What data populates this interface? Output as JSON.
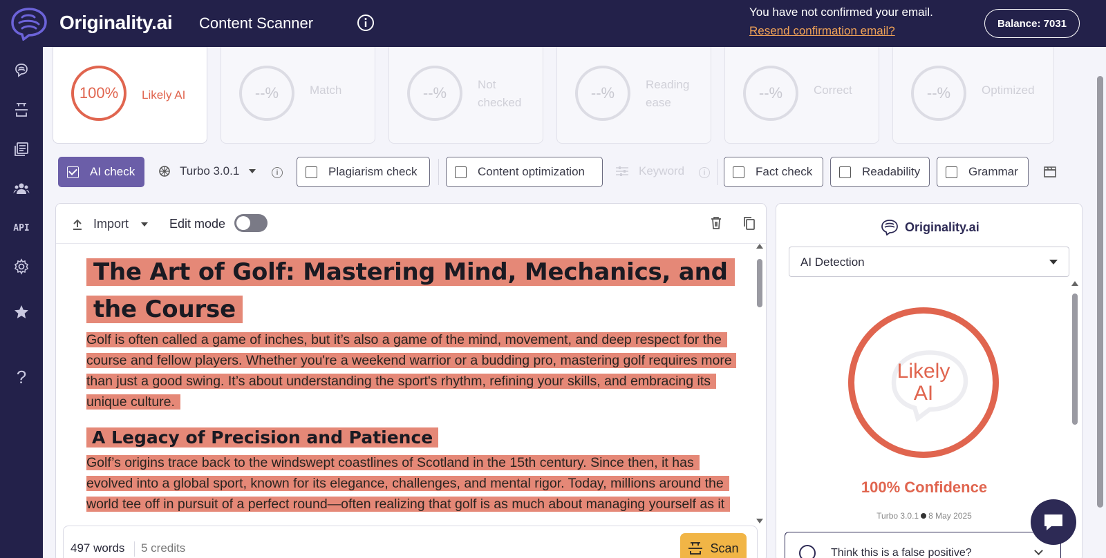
{
  "header": {
    "brand": "Originality.ai",
    "page_title": "Content Scanner",
    "email_warning": "You have not confirmed your email.",
    "resend_link": "Resend confirmation email?",
    "balance": "Balance: 7031"
  },
  "sidebar": {
    "items": [
      {
        "name": "brain-icon"
      },
      {
        "name": "scan-icon"
      },
      {
        "name": "library-icon"
      },
      {
        "name": "team-icon"
      },
      {
        "name": "api",
        "label": "API"
      },
      {
        "name": "gear-icon"
      },
      {
        "name": "star-icon"
      },
      {
        "name": "help-icon",
        "label": "?"
      }
    ]
  },
  "score_cards": [
    {
      "value": "100%",
      "label": "Likely AI",
      "active": true
    },
    {
      "value": "--%",
      "label": "Match"
    },
    {
      "value": "--%",
      "label": "Not checked"
    },
    {
      "value": "--%",
      "label": "Reading ease"
    },
    {
      "value": "--%",
      "label": "Correct"
    },
    {
      "value": "--%",
      "label": "Optimized"
    }
  ],
  "toolbar": {
    "ai_check": "AI check",
    "model": "Turbo 3.0.1",
    "plagiarism": "Plagiarism check",
    "content_opt": "Content optimization",
    "keyword": "Keyword",
    "fact_check": "Fact check",
    "readability": "Readability",
    "grammar": "Grammar"
  },
  "editor": {
    "import_label": "Import",
    "edit_mode_label": "Edit mode",
    "edit_mode_on": false,
    "h1": "The Art of Golf: Mastering Mind, Mechanics, and the Course",
    "p1": "Golf is often called a game of inches, but it’s also a game of the mind, movement, and deep respect for the course and fellow players.  Whether you're a weekend warrior or a budding pro, mastering golf requires more than just a good swing.  It’s about understanding the sport's rhythm, refining your skills, and embracing its unique culture.",
    "h2": "A Legacy of Precision and Patience",
    "p2": "Golf’s origins trace back to the windswept coastlines of Scotland in the 15th century.  Since then, it has evolved into a global sport, known for its elegance, challenges, and mental rigor.  Today, millions around the world tee off in pursuit of a perfect round—often realizing that golf is as much about managing yourself as it is about managing the ball.",
    "word_count": "497 words",
    "credits": "5 credits",
    "scan_label": "Scan"
  },
  "results": {
    "brand": "Originality.ai",
    "mode": "AI Detection",
    "ring_line1": "Likely",
    "ring_line2": "AI",
    "confidence": "100% Confidence",
    "model": "Turbo 3.0.1",
    "date": "8 May 2025",
    "false_positive": "Think this is a false positive?"
  },
  "colors": {
    "nav_bg": "#23214a",
    "accent_ai": "#e0654f",
    "highlight": "#e58877",
    "primary_btn": "#6b5ea8",
    "scan_btn": "#f1b546",
    "link": "#f0a257"
  }
}
